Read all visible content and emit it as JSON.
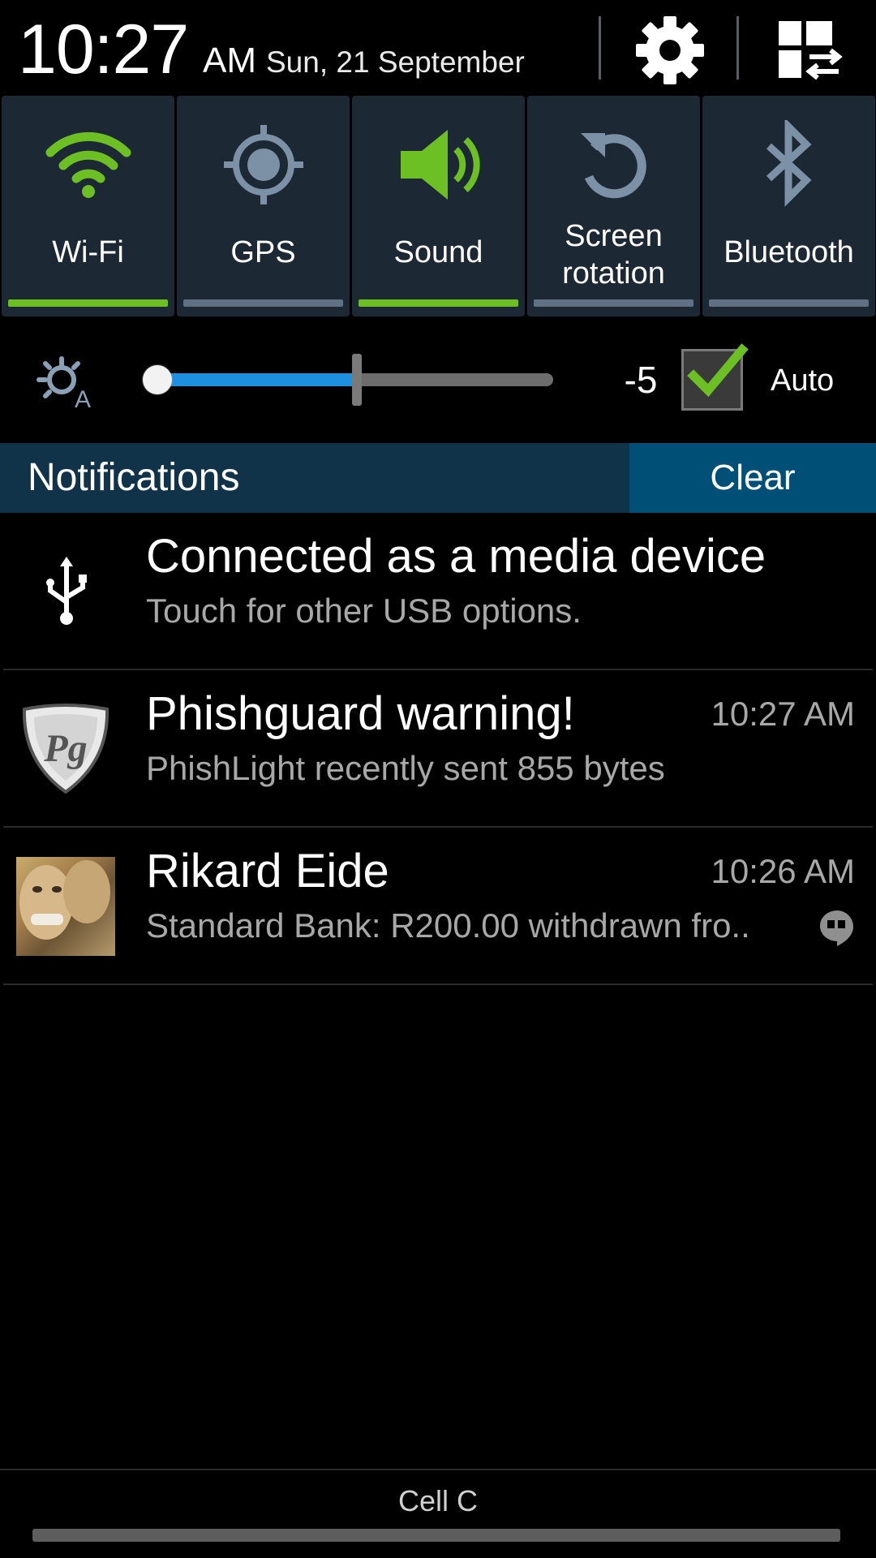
{
  "status": {
    "time": "10:27",
    "ampm": "AM",
    "date": "Sun, 21 September"
  },
  "header": {
    "settings_icon": "gear-icon",
    "edit_icon": "grid-swap-icon"
  },
  "quick_toggles": [
    {
      "label": "Wi-Fi",
      "icon": "wifi-icon",
      "on": true
    },
    {
      "label": "GPS",
      "icon": "gps-icon",
      "on": false
    },
    {
      "label": "Sound",
      "icon": "speaker-icon",
      "on": true
    },
    {
      "label": "Screen\nrotation",
      "icon": "rotate-icon",
      "on": false
    },
    {
      "label": "Bluetooth",
      "icon": "bluetooth-icon",
      "on": false
    }
  ],
  "brightness": {
    "value": "-5",
    "level_fraction": 0.5,
    "auto_checked": true,
    "auto_label": "Auto"
  },
  "notifications_header": {
    "title": "Notifications",
    "clear_label": "Clear"
  },
  "notifications": [
    {
      "title": "Connected as a media device",
      "subtitle": "Touch for other USB options.",
      "time": "",
      "icon": "usb-icon"
    },
    {
      "title": "Phishguard warning!",
      "subtitle": "PhishLight recently sent 855 bytes",
      "time": "10:27 AM",
      "icon": "phishguard-shield-icon"
    },
    {
      "title": "Rikard Eide",
      "subtitle": "Standard Bank: R200.00 withdrawn fro..",
      "time": "10:26 AM",
      "icon": "contact-avatar",
      "badge_icon": "hangouts-icon"
    }
  ],
  "carrier": "Cell C",
  "colors": {
    "toggle_on": "#6cc024",
    "toggle_off": "#5f7183",
    "tile_bg": "#1c2834",
    "slider_fill": "#1f8fe0",
    "notif_header_bg": "#10334a",
    "clear_bg": "#004f76"
  }
}
